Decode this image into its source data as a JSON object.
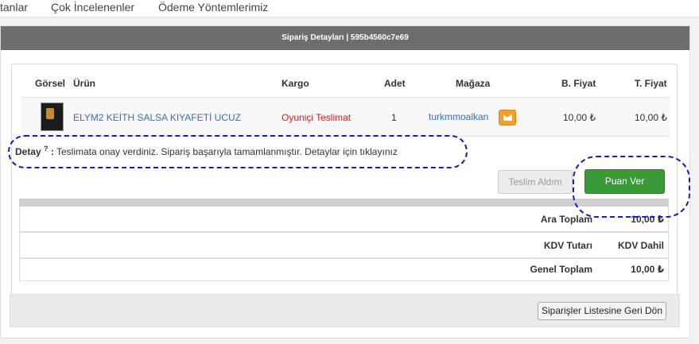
{
  "topnav": {
    "items": [
      {
        "label": "tanlar"
      },
      {
        "label": "Çok İncelenenler"
      },
      {
        "label": "Ödeme Yöntemlerimiz"
      }
    ]
  },
  "panel": {
    "title": "Sipariş Detayları | 595b4560c7e69"
  },
  "table": {
    "headers": {
      "image": "Görsel",
      "product": "Ürün",
      "cargo": "Kargo",
      "qty": "Adet",
      "store": "Mağaza",
      "unit_price": "B. Fiyat",
      "total_price": "T. Fiyat"
    },
    "row": {
      "product": "ELYM2 KEİTH SALSA KIYAFETİ UCUZ",
      "cargo": "Oyuniçi Teslimat",
      "qty": "1",
      "store": "turkmmoalkan",
      "unit_price": "10,00 ₺",
      "total_price": "10,00 ₺"
    }
  },
  "detail": {
    "label": "Detay",
    "sup": "?",
    "text": "Teslimata onay verdiniz. Sipariş başarıyla tamamlanmıştır. Detaylar için tıklayınız"
  },
  "actions": {
    "received_label": "Teslim Aldım",
    "rate_label": "Puan Ver"
  },
  "totals": {
    "subtotal_label": "Ara Toplam",
    "subtotal_value": "10,00 ₺",
    "vat_label": "KDV Tutarı",
    "vat_value": "KDV Dahil",
    "grand_label": "Genel Toplam",
    "grand_value": "10,00 ₺"
  },
  "footer": {
    "back_label": "Siparişler Listesine Geri Dön"
  },
  "colors": {
    "link": "#3a6fb0",
    "cargo": "#d22222",
    "green": "#3a9a3a",
    "header_bar": "#6d6d6d",
    "annotation": "#1a1ab8"
  }
}
